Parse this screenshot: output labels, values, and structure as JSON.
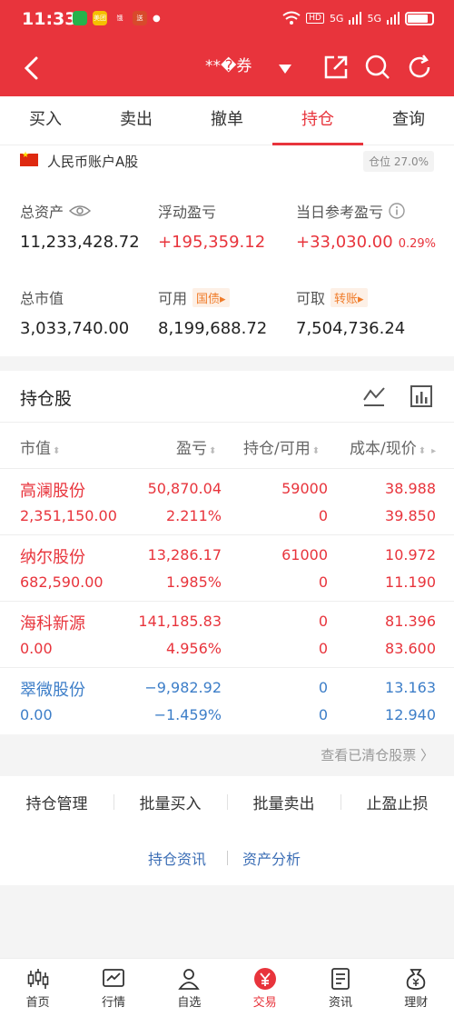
{
  "status_bar": {
    "time": "11:33",
    "net": "HD",
    "sig1": "5G",
    "sig2": "5G"
  },
  "status_apps": [
    {
      "label": "",
      "color": "#26b24b"
    },
    {
      "label": "美团",
      "color": "#f5c000"
    },
    {
      "label": "饿",
      "color": "#e8343c"
    },
    {
      "label": "送",
      "color": "#d84a2b"
    }
  ],
  "header": {
    "title": "**�券"
  },
  "tabs": [
    {
      "label": "买入"
    },
    {
      "label": "卖出"
    },
    {
      "label": "撤单"
    },
    {
      "label": "持仓",
      "active": true
    },
    {
      "label": "查询"
    }
  ],
  "account": {
    "name": "人民币账户A股",
    "position_badge": "仓位 27.0%",
    "total_assets_label": "总资产",
    "total_assets": "11,233,428.72",
    "float_pl_label": "浮动盈亏",
    "float_pl": "+195,359.12",
    "day_pl_label": "当日参考盈亏",
    "day_pl": "+33,030.00",
    "day_pl_pct": "0.29%",
    "market_value_label": "总市值",
    "market_value": "3,033,740.00",
    "available_label": "可用",
    "available_tag": "国债▸",
    "available": "8,199,688.72",
    "withdrawable_label": "可取",
    "withdrawable_tag": "转账▸",
    "withdrawable": "7,504,736.24"
  },
  "holdings": {
    "title": "持仓股",
    "columns": [
      "市值",
      "盈亏",
      "持仓/可用",
      "成本/现价"
    ],
    "rows": [
      {
        "name": "高澜股份",
        "market_value": "2,351,150.00",
        "pl": "50,870.04",
        "pl_pct": "2.211%",
        "position": "59000",
        "available": "0",
        "cost": "38.988",
        "price": "39.850",
        "trend": "up"
      },
      {
        "name": "纳尔股份",
        "market_value": "682,590.00",
        "pl": "13,286.17",
        "pl_pct": "1.985%",
        "position": "61000",
        "available": "0",
        "cost": "10.972",
        "price": "11.190",
        "trend": "up"
      },
      {
        "name": "海科新源",
        "market_value": "0.00",
        "pl": "141,185.83",
        "pl_pct": "4.956%",
        "position": "0",
        "available": "0",
        "cost": "81.396",
        "price": "83.600",
        "trend": "up"
      },
      {
        "name": "翠微股份",
        "market_value": "0.00",
        "pl": "−9,982.92",
        "pl_pct": "−1.459%",
        "position": "0",
        "available": "0",
        "cost": "13.163",
        "price": "12.940",
        "trend": "down"
      }
    ],
    "cleared_link": "查看已清仓股票 〉"
  },
  "actions": [
    {
      "label": "持仓管理"
    },
    {
      "label": "批量买入"
    },
    {
      "label": "批量卖出"
    },
    {
      "label": "止盈止损"
    }
  ],
  "info_links": {
    "left": "持仓资讯",
    "right": "资产分析"
  },
  "bottom_nav": [
    {
      "label": "首页",
      "icon": "candlestick-icon"
    },
    {
      "label": "行情",
      "icon": "chart-icon"
    },
    {
      "label": "自选",
      "icon": "user-star-icon"
    },
    {
      "label": "交易",
      "icon": "yuan-icon",
      "active": true
    },
    {
      "label": "资讯",
      "icon": "document-icon"
    },
    {
      "label": "理财",
      "icon": "money-bag-icon"
    }
  ],
  "colors": {
    "brand_red": "#e8343c",
    "gain": "#e8343c",
    "loss": "#3d7ec8",
    "tag_orange": "#f07c2a"
  }
}
